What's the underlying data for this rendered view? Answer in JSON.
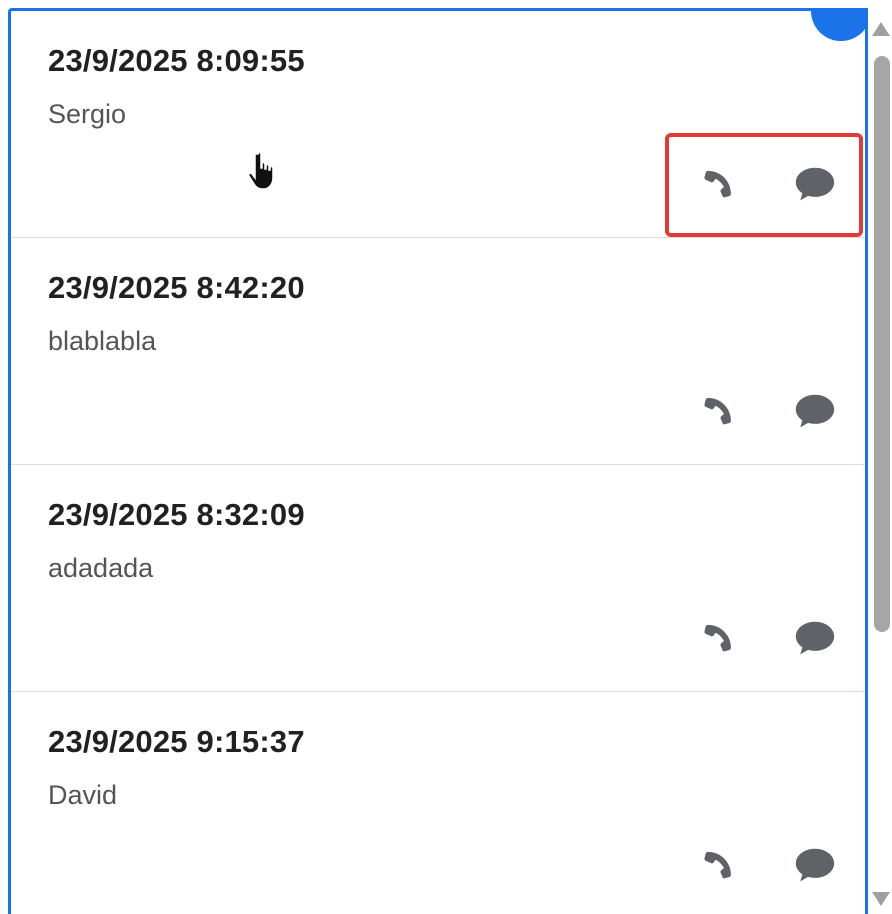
{
  "colors": {
    "accent": "#1a73e8",
    "highlight": "#e53935",
    "icon": "#5f6368"
  },
  "items": [
    {
      "time": "23/9/2025 8:09:55",
      "name": "Sergio",
      "highlighted": true
    },
    {
      "time": "23/9/2025 8:42:20",
      "name": "blablabla",
      "highlighted": false
    },
    {
      "time": "23/9/2025 8:32:09",
      "name": "adadada",
      "highlighted": false
    },
    {
      "time": "23/9/2025 9:15:37",
      "name": "David",
      "highlighted": false
    }
  ],
  "icons": {
    "call": "phone-icon",
    "message": "chat-bubble-icon"
  }
}
